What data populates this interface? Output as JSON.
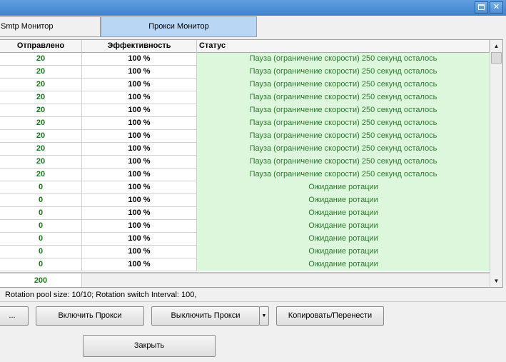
{
  "window": {
    "maximize_icon": "maximize-icon",
    "close_glyph": "✕"
  },
  "tabs": [
    {
      "label": "Smtp Монитор"
    },
    {
      "label": "Прокси Монитор"
    }
  ],
  "grid": {
    "columns": [
      "Отправлено",
      "Эффективность",
      "Статус"
    ],
    "rows": [
      {
        "sent": "20",
        "eff": "100 %",
        "status": "Пауза (ограничение скорости) 250 секунд осталось"
      },
      {
        "sent": "20",
        "eff": "100 %",
        "status": "Пауза (ограничение скорости) 250 секунд осталось"
      },
      {
        "sent": "20",
        "eff": "100 %",
        "status": "Пауза (ограничение скорости) 250 секунд осталось"
      },
      {
        "sent": "20",
        "eff": "100 %",
        "status": "Пауза (ограничение скорости) 250 секунд осталось"
      },
      {
        "sent": "20",
        "eff": "100 %",
        "status": "Пауза (ограничение скорости) 250 секунд осталось"
      },
      {
        "sent": "20",
        "eff": "100 %",
        "status": "Пауза (ограничение скорости) 250 секунд осталось"
      },
      {
        "sent": "20",
        "eff": "100 %",
        "status": "Пауза (ограничение скорости) 250 секунд осталось"
      },
      {
        "sent": "20",
        "eff": "100 %",
        "status": "Пауза (ограничение скорости) 250 секунд осталось"
      },
      {
        "sent": "20",
        "eff": "100 %",
        "status": "Пауза (ограничение скорости) 250 секунд осталось"
      },
      {
        "sent": "20",
        "eff": "100 %",
        "status": "Пауза (ограничение скорости) 250 секунд осталось"
      },
      {
        "sent": "0",
        "eff": "100 %",
        "status": "Ожидание ротации"
      },
      {
        "sent": "0",
        "eff": "100 %",
        "status": "Ожидание ротации"
      },
      {
        "sent": "0",
        "eff": "100 %",
        "status": "Ожидание ротации"
      },
      {
        "sent": "0",
        "eff": "100 %",
        "status": "Ожидание ротации"
      },
      {
        "sent": "0",
        "eff": "100 %",
        "status": "Ожидание ротации"
      },
      {
        "sent": "0",
        "eff": "100 %",
        "status": "Ожидание ротации"
      },
      {
        "sent": "0",
        "eff": "100 %",
        "status": "Ожидание ротации"
      }
    ],
    "total_sent": "200"
  },
  "status_line": "Rotation pool size: 10/10;   Rotation switch Interval: 100,",
  "buttons": {
    "dots": "...",
    "enable_proxy": "Включить Прокси",
    "disable_proxy": "Выключить Прокси",
    "copy_move": "Копировать/Перенести",
    "close": "Закрыть"
  },
  "colors": {
    "status_bg": "#ddf7dd",
    "status_text": "#2e7a2e",
    "sent_text": "#1a7a1a",
    "active_tab": "#b9d6f4",
    "titlebar": "#4a8fd8"
  }
}
